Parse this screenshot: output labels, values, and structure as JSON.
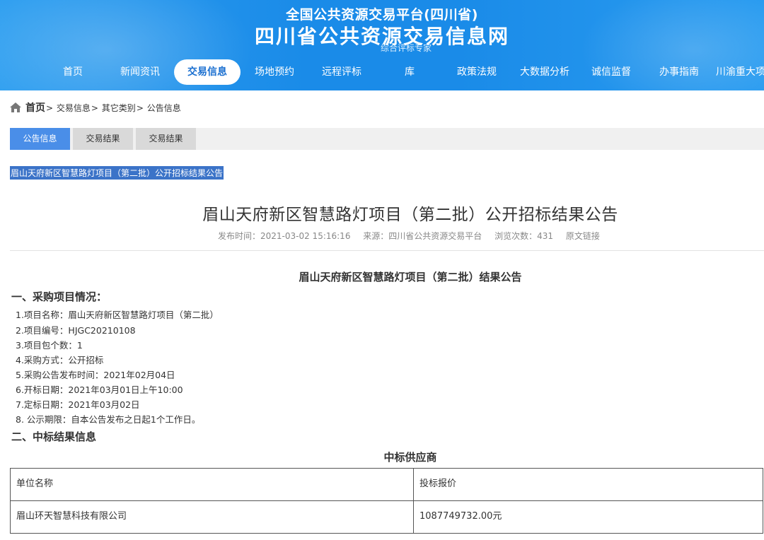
{
  "header": {
    "subtitle": "全国公共资源交易平台(四川省)",
    "title": "四川省公共资源交易信息网",
    "overlay_text": "综合评标专家"
  },
  "nav": {
    "items": [
      {
        "label": "首页"
      },
      {
        "label": "新闻资讯"
      },
      {
        "label": "交易信息",
        "active": true
      },
      {
        "label": "场地预约"
      },
      {
        "label": "远程评标"
      },
      {
        "label": "库"
      },
      {
        "label": "政策法规"
      },
      {
        "label": "大数据分析"
      },
      {
        "label": "诚信监督"
      },
      {
        "label": "办事指南"
      },
      {
        "label": "川渝重大项"
      }
    ]
  },
  "breadcrumb": {
    "home": "首页",
    "separator": ">",
    "items": [
      "交易信息",
      "其它类别",
      "公告信息"
    ]
  },
  "tabs": [
    {
      "label": "公告信息",
      "active": true
    },
    {
      "label": "交易结果"
    },
    {
      "label": "交易结果"
    }
  ],
  "selected_title": "眉山天府新区智慧路灯项目（第二批）公开招标结果公告",
  "article": {
    "title": "眉山天府新区智慧路灯项目（第二批）公开招标结果公告",
    "publish_time": "发布时间：2021-03-02 15:16:16",
    "source": "来源：四川省公共资源交易平台",
    "views": "浏览次数：431",
    "original_link": "原文链接"
  },
  "document": {
    "heading": "眉山天府新区智慧路灯项目（第二批）结果公告",
    "section1": "一、采购项目情况：",
    "items": [
      "1.项目名称：眉山天府新区智慧路灯项目（第二批）",
      "2.项目编号：HJGC20210108",
      "3.项目包个数：1",
      "4.采购方式：公开招标",
      "5.采购公告发布时间：2021年02月04日",
      "6.开标日期：2021年03月01日上午10:00",
      "7.定标日期：2021年03月02日",
      "8. 公示期限：自本公告发布之日起1个工作日。"
    ],
    "section2": "二、中标结果信息",
    "table_caption": "中标供应商",
    "table": {
      "headers": [
        "单位名称",
        "投标报价"
      ],
      "rows": [
        [
          "眉山环天智慧科技有限公司",
          "1087749732.00元"
        ]
      ]
    }
  },
  "colors": {
    "header_blue": "#1a8be8",
    "active_tab": "#4a8ee8",
    "selection": "#3b73c8"
  }
}
